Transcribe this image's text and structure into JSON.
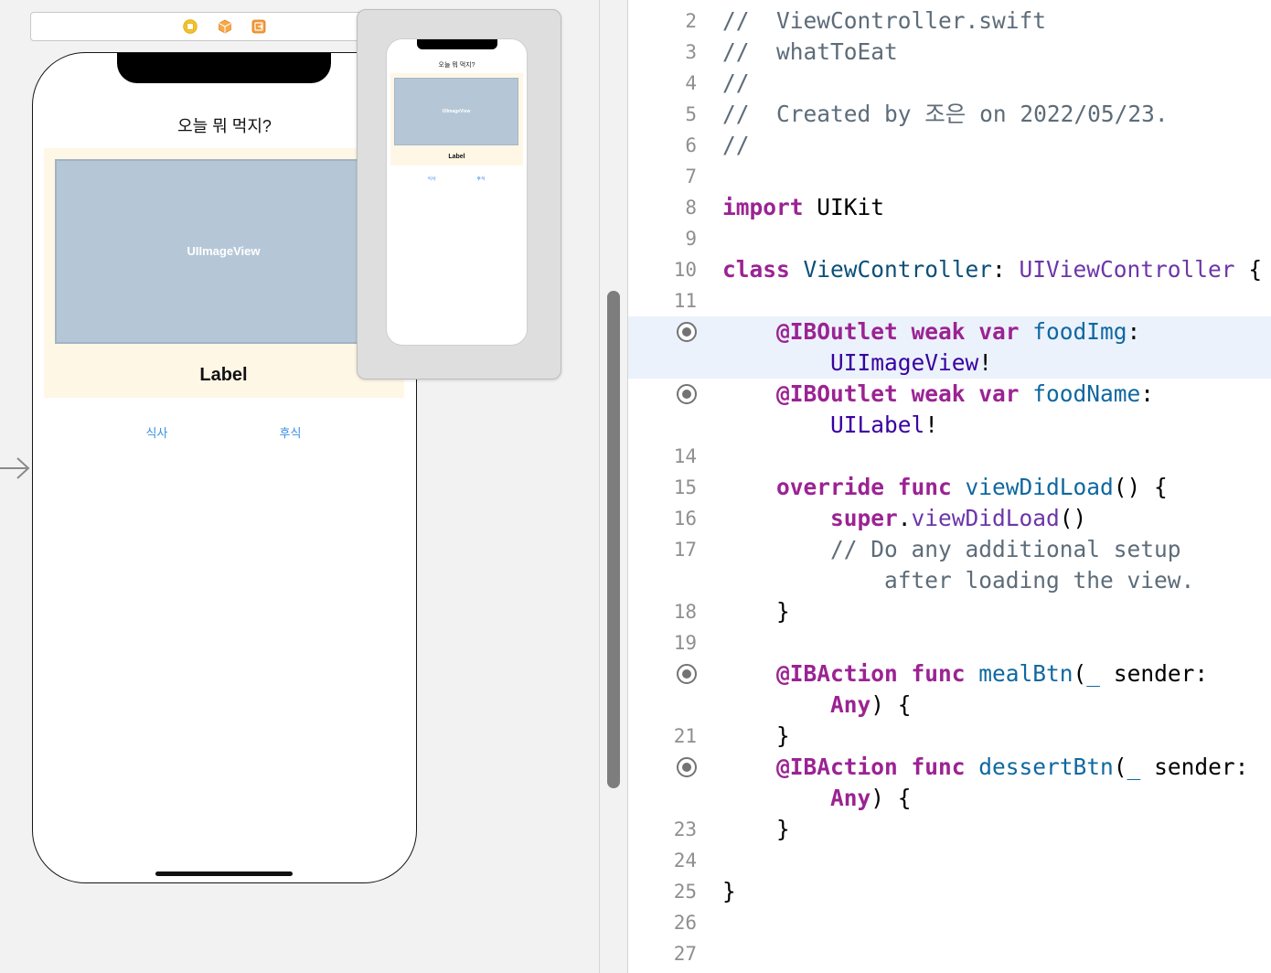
{
  "storyboard": {
    "colors": {
      "canvas_bg": "#f2f2f2",
      "content_panel": "#fff7e6",
      "image_view_bg": "#b5c7d7",
      "button_text": "#3c8fe4"
    },
    "scene_dock": {
      "icons": [
        "view-controller-icon",
        "first-responder-icon",
        "exit-icon"
      ]
    },
    "entry_point": {
      "icon": "arrow-right-icon"
    },
    "screen": {
      "title": "오늘 뭐 먹지?",
      "image_view": "UIImageView",
      "label": "Label",
      "meal_button": "식사",
      "dessert_button": "후식"
    },
    "minimap": {
      "title": "오늘 뭐 먹지?",
      "image_view": "UIImageView",
      "label": "Label",
      "meal_button": "식사",
      "dessert_button": "후식"
    }
  },
  "editor": {
    "colors": {
      "background": "#ffffff",
      "highlight": "#ebf2fc",
      "line_number": "#8f8f8f",
      "connection_marker": "#737373"
    },
    "lines": [
      {
        "number": "2",
        "tokens": [
          {
            "text": "//  ViewController.swift",
            "color": "#5d6c79"
          }
        ]
      },
      {
        "number": "3",
        "tokens": [
          {
            "text": "//  whatToEat",
            "color": "#5d6c79"
          }
        ]
      },
      {
        "number": "4",
        "tokens": [
          {
            "text": "//",
            "color": "#5d6c79"
          }
        ]
      },
      {
        "number": "5",
        "tokens": [
          {
            "text": "//  Created by 조은 on 2022/05/23.",
            "color": "#5d6c79"
          }
        ]
      },
      {
        "number": "6",
        "tokens": [
          {
            "text": "//",
            "color": "#5d6c79"
          }
        ]
      },
      {
        "number": "7",
        "tokens": []
      },
      {
        "number": "8",
        "tokens": [
          {
            "text": "import",
            "color": "#9b2393",
            "bold": true
          },
          {
            "text": " UIKit"
          }
        ]
      },
      {
        "number": "9",
        "tokens": []
      },
      {
        "number": "10",
        "tokens": [
          {
            "text": "class",
            "color": "#9b2393",
            "bold": true
          },
          {
            "text": " ViewController",
            "color": "#0b4f79"
          },
          {
            "text": ": "
          },
          {
            "text": "UIViewController",
            "color": "#6c36a9"
          },
          {
            "text": " {"
          }
        ]
      },
      {
        "number": "11",
        "tokens": []
      },
      {
        "connected": true,
        "highlight": true,
        "tokens": [
          {
            "text": "    @IBOutlet weak var",
            "color": "#9b2393",
            "bold": true
          },
          {
            "text": " foodImg",
            "color": "#0f68a0"
          },
          {
            "text": ":"
          }
        ]
      },
      {
        "highlight": true,
        "tokens": [
          {
            "text": "        UIImageView",
            "color": "#3900a0"
          },
          {
            "text": "!"
          }
        ]
      },
      {
        "connected": true,
        "tokens": [
          {
            "text": "    @IBOutlet weak var",
            "color": "#9b2393",
            "bold": true
          },
          {
            "text": " foodName",
            "color": "#0f68a0"
          },
          {
            "text": ":"
          }
        ]
      },
      {
        "tokens": [
          {
            "text": "        UILabel",
            "color": "#3900a0"
          },
          {
            "text": "!"
          }
        ]
      },
      {
        "number": "14",
        "tokens": []
      },
      {
        "number": "15",
        "tokens": [
          {
            "text": "    override func",
            "color": "#9b2393",
            "bold": true
          },
          {
            "text": " viewDidLoad",
            "color": "#0f68a0"
          },
          {
            "text": "() {"
          }
        ]
      },
      {
        "number": "16",
        "tokens": [
          {
            "text": "        super",
            "color": "#9b2393",
            "bold": true
          },
          {
            "text": "."
          },
          {
            "text": "viewDidLoad",
            "color": "#6c36a9"
          },
          {
            "text": "()"
          }
        ]
      },
      {
        "number": "17",
        "tokens": [
          {
            "text": "        // Do any additional setup",
            "color": "#5d6c79"
          }
        ]
      },
      {
        "tokens": [
          {
            "text": "            after loading the view.",
            "color": "#5d6c79"
          }
        ]
      },
      {
        "number": "18",
        "tokens": [
          {
            "text": "    }"
          }
        ]
      },
      {
        "number": "19",
        "tokens": []
      },
      {
        "connected": true,
        "tokens": [
          {
            "text": "    @IBAction func",
            "color": "#9b2393",
            "bold": true
          },
          {
            "text": " mealBtn",
            "color": "#0f68a0"
          },
          {
            "text": "("
          },
          {
            "text": "_",
            "color": "#0f68a0"
          },
          {
            "text": " sender:"
          }
        ]
      },
      {
        "tokens": [
          {
            "text": "        Any",
            "color": "#9b2393",
            "bold": true
          },
          {
            "text": ") {"
          }
        ]
      },
      {
        "number": "21",
        "tokens": [
          {
            "text": "    }"
          }
        ]
      },
      {
        "connected": true,
        "tokens": [
          {
            "text": "    @IBAction func",
            "color": "#9b2393",
            "bold": true
          },
          {
            "text": " dessertBtn",
            "color": "#0f68a0"
          },
          {
            "text": "("
          },
          {
            "text": "_",
            "color": "#0f68a0"
          },
          {
            "text": " sender:"
          }
        ]
      },
      {
        "tokens": [
          {
            "text": "        Any",
            "color": "#9b2393",
            "bold": true
          },
          {
            "text": ") {"
          }
        ]
      },
      {
        "number": "23",
        "tokens": [
          {
            "text": "    }"
          }
        ]
      },
      {
        "number": "24",
        "tokens": []
      },
      {
        "number": "25",
        "tokens": [
          {
            "text": "}"
          }
        ]
      },
      {
        "number": "26",
        "tokens": []
      },
      {
        "number": "27",
        "tokens": []
      }
    ]
  }
}
